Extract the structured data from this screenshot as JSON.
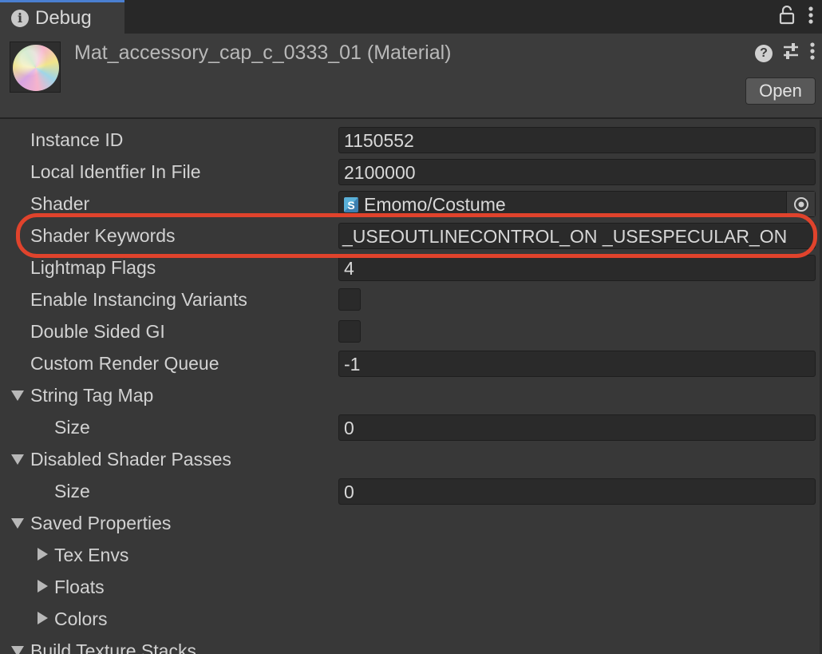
{
  "tab": {
    "label": "Debug",
    "icon": "info-icon"
  },
  "header": {
    "title": "Mat_accessory_cap_c_0333_01 (Material)",
    "open_label": "Open"
  },
  "properties": {
    "instance_id": {
      "label": "Instance ID",
      "value": "1150552"
    },
    "local_identifier": {
      "label": "Local Identfier In File",
      "value": "2100000"
    },
    "shader": {
      "label": "Shader",
      "value": "Emomo/Costume",
      "icon_letter": "S"
    },
    "shader_keywords": {
      "label": "Shader Keywords",
      "value": "_USEOUTLINECONTROL_ON _USESPECULAR_ON"
    },
    "lightmap_flags": {
      "label": "Lightmap Flags",
      "value": "4"
    },
    "enable_instancing": {
      "label": "Enable Instancing Variants",
      "checked": false
    },
    "double_sided_gi": {
      "label": "Double Sided GI",
      "checked": false
    },
    "custom_render_queue": {
      "label": "Custom Render Queue",
      "value": "-1"
    },
    "string_tag_map": {
      "label": "String Tag Map",
      "size_label": "Size",
      "size_value": "0",
      "expanded": true
    },
    "disabled_shader_passes": {
      "label": "Disabled Shader Passes",
      "size_label": "Size",
      "size_value": "0",
      "expanded": true
    },
    "saved_properties": {
      "label": "Saved Properties",
      "expanded": true,
      "children": [
        {
          "label": "Tex Envs",
          "expanded": false
        },
        {
          "label": "Floats",
          "expanded": false
        },
        {
          "label": "Colors",
          "expanded": false
        }
      ]
    },
    "build_texture_stacks": {
      "label": "Build Texture Stacks",
      "expanded": true
    }
  },
  "colors": {
    "panel_bg": "#383838",
    "field_bg": "#2a2a2a",
    "tab_accent": "#4a7fd1",
    "highlight": "#e0432c"
  }
}
